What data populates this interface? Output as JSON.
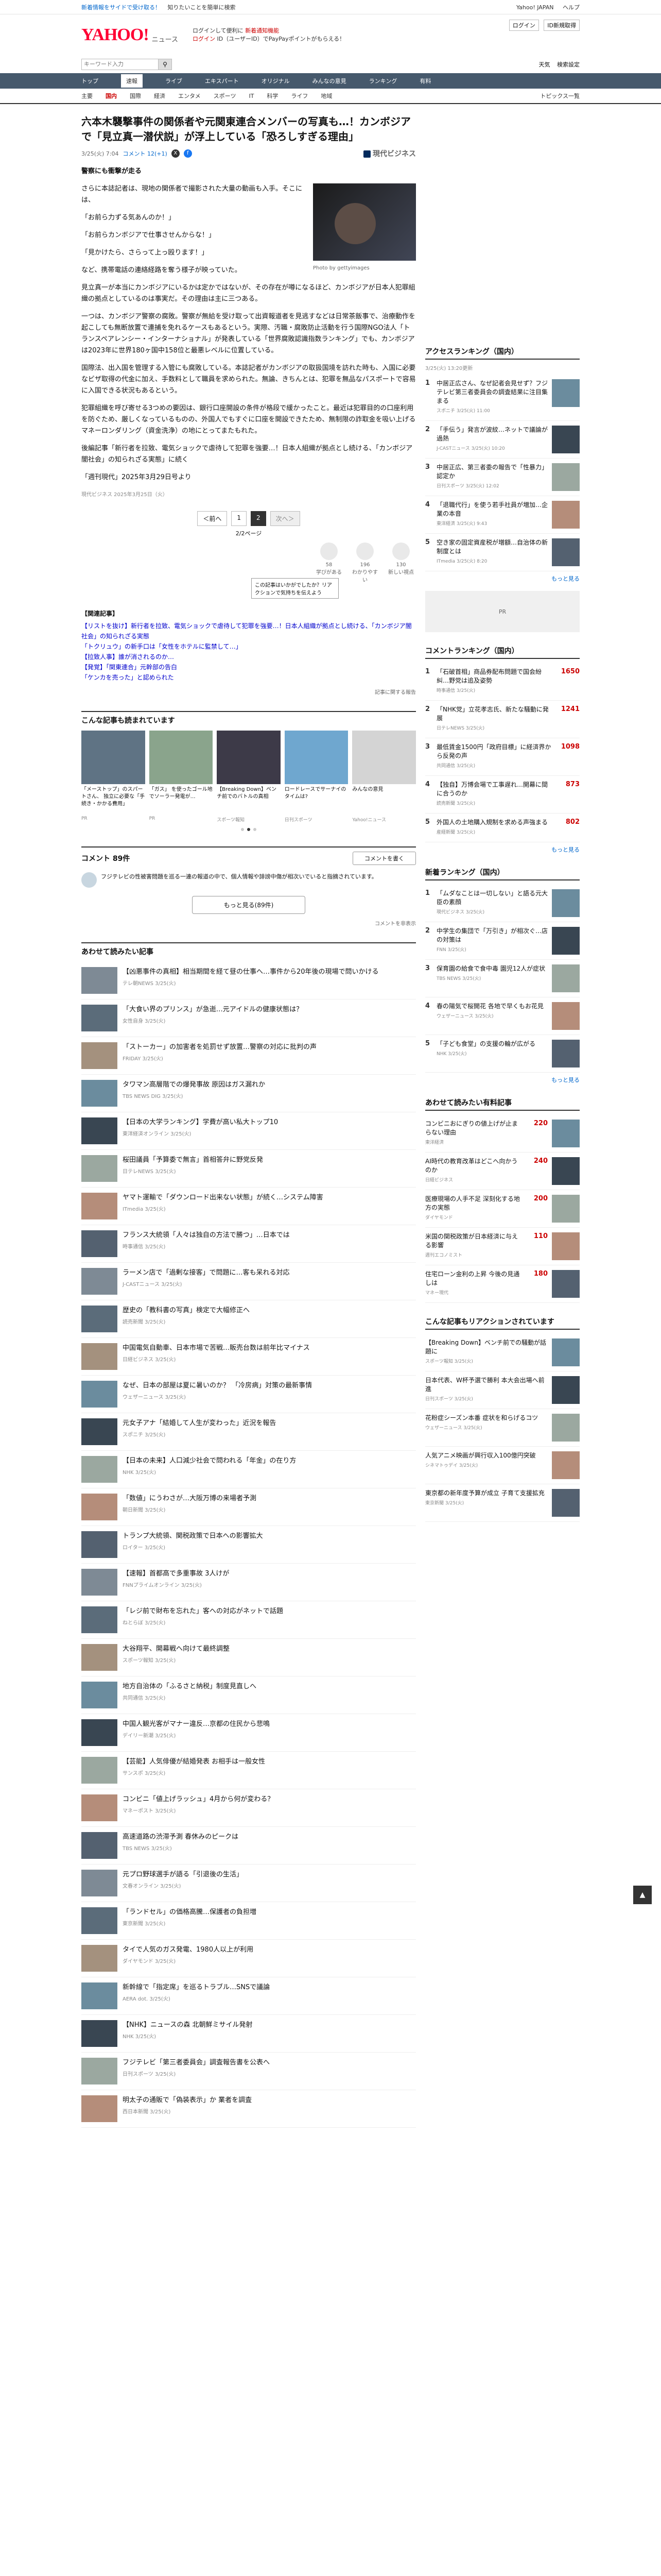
{
  "topbar": {
    "left": "新着情報をサイドで受け取る！",
    "mid": "知りたいことを簡単に検索",
    "links": [
      "Yahoo! JAPAN",
      "ヘルプ"
    ]
  },
  "brand": {
    "name": "YAHOO!",
    "sub": "ニュース"
  },
  "promo": {
    "line1": "ログインして便利に",
    "line1_hl": "新着通知機能",
    "line2": "ログイン",
    "line2_rest": "ID（ユーザーID）でPayPayポイントがもらえる！"
  },
  "mast_right": {
    "login": "ログイン",
    "register": "ID新規取得"
  },
  "search": {
    "placeholder": "キーワード入力",
    "btn": "検索",
    "right": [
      "天気",
      "検索設定"
    ]
  },
  "categories": [
    "トップ",
    "速報",
    "ライブ",
    "エキスパート",
    "オリジナル",
    "みんなの意見",
    "ランキング",
    "有料"
  ],
  "active_category": "速報",
  "subnav": [
    "主要",
    "国内",
    "国際",
    "経済",
    "エンタメ",
    "スポーツ",
    "IT",
    "科学",
    "ライフ",
    "地域"
  ],
  "active_subnav": "国内",
  "subnav_right": "トピックス一覧",
  "article": {
    "title": "六本木襲撃事件の関係者や元関東連合メンバーの写真も…！カンボジアで「見立真一潜伏説」が浮上している「恐ろしすぎる理由」",
    "date": "3/25(火) 7:04",
    "comments": "コメント 12(+1)",
    "publisher": "現代ビジネス",
    "subhead": "警察にも衝撃が走る",
    "photo_credit": "Photo by gettyimages",
    "paras": [
      "さらに本誌記者は、現地の関係者で撮影された大量の動画も入手。そこには、",
      "「お前ら力ずる気あんのか！」",
      "「お前らカンボジアで仕事させんからな！」",
      "「見かけたら、さらって上っ殴ります！」",
      "など、携帯電話の連絡経路を奪う様子が映っていた。",
      "見立真一が本当にカンボジアにいるかは定かではないが、その存在が噂になるほど、カンボジアが日本人犯罪組織の拠点としているのは事実だ。その理由は主に三つある。",
      "一つは、カンボジア警察の腐敗。警察が無給を受け取って出資報道者を見逃すなどは日常茶飯事で、治療動作を起こしても無断放置で連捕を免れるケースもあるという。実際、汚職・腐敗防止活動を行う国際NGO法人「トランスペアレンシー・インターナショナル」が発表している「世界腐敗認識指数ランキング」でも、カンボジアは2023年に世界180ヶ国中158位と最悪レベルに位置している。",
      "国際法、出入国を管理する入管にも腐敗している。本誌記者がカンボジアの取扱国境を訪れた時も、入国に必要なビザ取得の代金に加え、手数料として職員を求められた。無論、きちんとは、犯罪を無品なパスポートで容易に入国できる状況もあるという。",
      "犯罪組織を呼び寄せる3つめの要因は、銀行口座開設の条件が格段で緩かったこと。最近は犯罪目的の口座利用を防ぐため、厳しくなっているものの、外国人でもすぐに口座を開設できたため、無制限の詐取金を吸い上げるマネーロンダリング（資金洗浄）の地にとってまたもれた。",
      "後編記事「新行者を拉致、電気ショックで虐待して犯罪を強要…！日本人組織が拠点とし続ける、「カンボジア闇社会」の知られざる実態」に続く",
      "「週刊現代」2025年3月29日号より"
    ],
    "footnote": "現代ビジネス 2025年3月25日（火）",
    "pager": {
      "prev": "＜前へ",
      "p1": "1",
      "p2": "2",
      "next": "次へ＞",
      "count": "2/2ページ"
    },
    "reactions": [
      {
        "label": "学びがある",
        "count": "58"
      },
      {
        "label": "わかりやすい",
        "count": "196"
      },
      {
        "label": "新しい視点",
        "count": "130"
      }
    ],
    "tooltip": "この記事はいかがでしたか？リアクションで気持ちを伝えよう",
    "related_label": "【関連記事】",
    "related": [
      "【リストを抜け】新行者を拉致、電気ショックで虐待して犯罪を強要…！日本人組織が拠点とし続ける、「カンボジア闇社会」の知られざる実態",
      "「トクリュウ」の新手口は「女性をホテルに監禁して…」",
      "【拉致人事】誰が消されるのか…",
      "【発覚】「関東連合」元幹部の告白",
      "「ケンカを売った」と認められた"
    ],
    "report": "記事に関する報告"
  },
  "recommend": {
    "title": "こんな記事も読まれています",
    "items": [
      {
        "t": "「メーストップ」のスパートさん、 独立に必要な「手続き・かかる費用」",
        "s": "PR"
      },
      {
        "t": "「ガス」 を使ったゴール地でソーラー発電が…",
        "s": "PR"
      },
      {
        "t": "【Breaking Down】ベンチ前でのバトルの真相",
        "s": "スポーツ報知"
      },
      {
        "t": "ロードレースでサーナイのタイムは?",
        "s": "日刊スポーツ"
      },
      {
        "t": "みんなの意見",
        "s": "Yahoo!ニュース"
      }
    ]
  },
  "comments": {
    "title": "コメント 89件",
    "btn": "コメントを書く",
    "card_text": "フジテレビの性被害問題を巡る一連の報道の中で、個人情報や誹謗中傷が相次いでいると指摘されています。",
    "more": "もっと見る(89件)",
    "opts": "コメントを非表示"
  },
  "feed_title": "あわせて読みたい記事",
  "feed": [
    {
      "t": "【凶悪事件の真相】相当期間を経て昼の仕事へ…事件から20年後の現場で問いかける",
      "s": "テレ朝NEWS 3/25(火)"
    },
    {
      "t": "「大食い界のプリンス」が急逝…元アイドルの健康状態は？",
      "s": "女性自身 3/25(火)"
    },
    {
      "t": "「ストーカー」の加害者を処罰せず放置…警察の対応に批判の声",
      "s": "FRIDAY 3/25(火)"
    },
    {
      "t": "タワマン高層階での爆発事故 原因はガス漏れか",
      "s": "TBS NEWS DIG 3/25(火)"
    },
    {
      "t": "【日本の大学ランキング】学費が高い私大トップ10",
      "s": "東洋経済オンライン 3/25(火)"
    },
    {
      "t": "桜田議員「予算委で無言」首相答弁に野党反発",
      "s": "日テレNEWS 3/25(火)"
    },
    {
      "t": "ヤマト運輸で「ダウンロード出来ない状態」が続く…システム障害",
      "s": "ITmedia 3/25(火)"
    },
    {
      "t": "フランス大統領「人々は独自の方法で勝つ」…日本では",
      "s": "時事通信 3/25(火)"
    },
    {
      "t": "ラーメン店で「過剰な接客」で問題に…客も呆れる対応",
      "s": "J-CASTニュース 3/25(火)"
    },
    {
      "t": "歴史の「教科書の写真」検定で大幅修正へ",
      "s": "読売新聞 3/25(火)"
    },
    {
      "t": "中国電気自動車、日本市場で苦戦…販売台数は前年比マイナス",
      "s": "日経ビジネス 3/25(火)"
    },
    {
      "t": "なぜ、日本の部屋は夏に暑いのか？ 「冷房病」対策の最新事情",
      "s": "ウェザーニュース 3/25(火)"
    },
    {
      "t": "元女子アナ「結婚して人生が変わった」近況を報告",
      "s": "スポニチ 3/25(火)"
    },
    {
      "t": "【日本の未来】人口減少社会で問われる「年金」の在り方",
      "s": "NHK 3/25(火)"
    },
    {
      "t": "「数値」にうわさが…大阪万博の来場者予測",
      "s": "朝日新聞 3/25(火)"
    },
    {
      "t": "トランプ大統領、関税政策で日本への影響拡大",
      "s": "ロイター 3/25(火)"
    },
    {
      "t": "【速報】首都高で多重事故 3人けが",
      "s": "FNNプライムオンライン 3/25(火)"
    },
    {
      "t": "「レジ前で財布を忘れた」客への対応がネットで話題",
      "s": "ねとらぼ 3/25(火)"
    },
    {
      "t": "大谷翔平、開幕戦へ向けて最終調整",
      "s": "スポーツ報知 3/25(火)"
    },
    {
      "t": "地方自治体の「ふるさと納税」制度見直しへ",
      "s": "共同通信 3/25(火)"
    },
    {
      "t": "中国人観光客がマナー違反…京都の住民から悲鳴",
      "s": "デイリー新潮 3/25(火)"
    },
    {
      "t": "【芸能】人気俳優が結婚発表 お相手は一般女性",
      "s": "サンスポ 3/25(火)"
    },
    {
      "t": "コンビニ「値上げラッシュ」4月から何が変わる？",
      "s": "マネーポスト 3/25(火)"
    },
    {
      "t": "高速道路の渋滞予測 春休みのピークは",
      "s": "TBS NEWS 3/25(火)"
    },
    {
      "t": "元プロ野球選手が語る「引退後の生活」",
      "s": "文春オンライン 3/25(火)"
    },
    {
      "t": "「ランドセル」の価格高騰…保護者の負担増",
      "s": "東京新聞 3/25(火)"
    },
    {
      "t": "タイで人気のガス発電、1980人以上が利用",
      "s": "ダイヤモンド 3/25(火)"
    },
    {
      "t": "新幹線で「指定席」を巡るトラブル…SNSで議論",
      "s": "AERA dot. 3/25(火)"
    },
    {
      "t": "【NHK】ニュースの森 北朝鮮ミサイル発射",
      "s": "NHK 3/25(火)"
    },
    {
      "t": "フジテレビ「第三者委員会」調査報告書を公表へ",
      "s": "日刊スポーツ 3/25(火)"
    },
    {
      "t": "明太子の通販で「偽装表示」か 業者を調査",
      "s": "西日本新聞 3/25(火)"
    }
  ],
  "sidebar": {
    "access_title": "アクセスランキング（国内）",
    "access_sub": "3/25(火) 13:20更新",
    "access": [
      {
        "t": "中居正広さん、なぜ記者会見せず？フジテレビ第三者委員会の調査結果に注目集まる",
        "s": "スポニチ 3/25(火) 11:00"
      },
      {
        "t": "「手伝う」発言が波紋…ネットで議論が過熱",
        "s": "J-CASTニュース 3/25(火) 10:20"
      },
      {
        "t": "中居正広、第三者委の報告で「性暴力」認定か",
        "s": "日刊スポーツ 3/25(火) 12:02"
      },
      {
        "t": "「退職代行」を使う若手社員が増加…企業の本音",
        "s": "東洋経済 3/25(火) 9:43"
      },
      {
        "t": "空き家の固定資産税が増額…自治体の新制度とは",
        "s": "ITmedia 3/25(火) 8:20"
      }
    ],
    "comment_title": "コメントランキング（国内）",
    "comment_rank": [
      {
        "t": "「石破首相」商品券配布問題で国会紛糾…野党は追及姿勢",
        "s": "時事通信 3/25(火)",
        "c": "1650"
      },
      {
        "t": "「NHK党」立花孝志氏、新たな騒動に発展",
        "s": "日テレNEWS 3/25(火)",
        "c": "1241"
      },
      {
        "t": "最低賃金1500円「政府目標」に経済界から反発の声",
        "s": "共同通信 3/25(火)",
        "c": "1098"
      },
      {
        "t": "【独自】万博会場で工事遅れ…開幕に間に合うのか",
        "s": "読売新聞 3/25(火)",
        "c": "873"
      },
      {
        "t": "外国人の土地購入規制を求める声強まる",
        "s": "産経新聞 3/25(火)",
        "c": "802"
      }
    ],
    "word_title": "新着ランキング（国内）",
    "word_rank": [
      {
        "t": "「ムダなことは一切しない」と語る元大臣の素顔",
        "s": "現代ビジネス 3/25(火)"
      },
      {
        "t": "中学生の集団で「万引き」が相次ぐ…店の対策は",
        "s": "FNN 3/25(火)"
      },
      {
        "t": "保育園の給食で食中毒 園児12人が症状",
        "s": "TBS NEWS 3/25(火)"
      },
      {
        "t": "春の陽気で桜開花 各地で早くもお花見",
        "s": "ウェザーニュース 3/25(火)"
      },
      {
        "t": "「子ども食堂」の支援の輪が広がる",
        "s": "NHK 3/25(火)"
      }
    ],
    "expert_title": "あわせて読みたい有料記事",
    "expert": [
      {
        "t": "コンビニおにぎりの値上げが止まらない理由",
        "s": "東洋経済",
        "c": "220"
      },
      {
        "t": "AI時代の教育改革はどこへ向かうのか",
        "s": "日経ビジネス",
        "c": "240"
      },
      {
        "t": "医療現場の人手不足 深刻化する地方の実態",
        "s": "ダイヤモンド",
        "c": "200"
      },
      {
        "t": "米国の関税政策が日本経済に与える影響",
        "s": "週刊エコノミスト",
        "c": "110"
      },
      {
        "t": "住宅ローン金利の上昇 今後の見通しは",
        "s": "マネー現代",
        "c": "180"
      }
    ],
    "topic_title": "こんな記事もリアクションされています",
    "topic": [
      {
        "t": "【Breaking Down】ベンチ前での騒動が話題に",
        "s": "スポーツ報知 3/25(火)"
      },
      {
        "t": "日本代表、W杯予選で勝利 本大会出場へ前進",
        "s": "日刊スポーツ 3/25(火)"
      },
      {
        "t": "花粉症シーズン本番 症状を和らげるコツ",
        "s": "ウェザーニュース 3/25(火)"
      },
      {
        "t": "人気アニメ映画が興行収入100億円突破",
        "s": "シネマトゥデイ 3/25(火)"
      },
      {
        "t": "東京都の新年度予算が成立 子育て支援拡充",
        "s": "東京新聞 3/25(火)"
      }
    ],
    "more": "もっと見る"
  },
  "backtop": "▲"
}
